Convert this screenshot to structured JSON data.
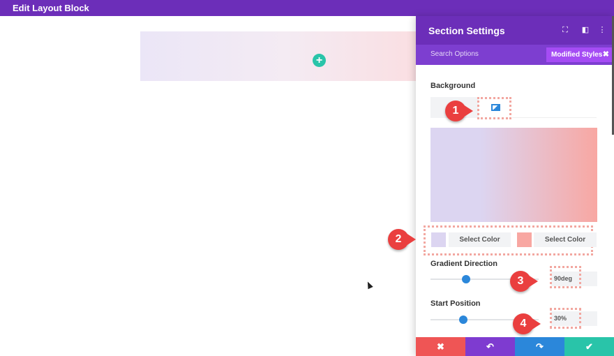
{
  "topbar": {
    "title": "Edit Layout Block"
  },
  "canvas": {
    "add_icon": "+"
  },
  "panel": {
    "title": "Section Settings",
    "header_icons": [
      "expand-icon",
      "sidebar-toggle-icon",
      "more-options-icon"
    ],
    "header_icon_glyphs": [
      "⛶",
      "◧",
      "⋮"
    ],
    "search_placeholder": "Search Options",
    "modified_styles_label": "Modified Styles",
    "modified_close": "✖",
    "background_label": "Background",
    "color_stop_1": {
      "swatch": "#dcd5f1",
      "button_label": "Select Color"
    },
    "color_stop_2": {
      "swatch": "#f8a7a2",
      "button_label": "Select Color"
    },
    "gradient_direction": {
      "label": "Gradient Direction",
      "value": "90deg",
      "slider_fraction": 0.33
    },
    "start_position": {
      "label": "Start Position",
      "value": "30%",
      "slider_fraction": 0.3
    },
    "footer": {
      "cancel_glyph": "✖",
      "undo_glyph": "↶",
      "redo_glyph": "↷",
      "save_glyph": "✔",
      "colors": {
        "cancel": "#ef5555",
        "undo": "#7e3bd0",
        "redo": "#2b87da",
        "save": "#29c4a9"
      }
    }
  },
  "callouts": [
    "1",
    "2",
    "3",
    "4"
  ],
  "colors": {
    "accent_purple": "#6c2eb9",
    "accent_blue": "#2b87da",
    "callout_red": "#ea3f3f"
  }
}
